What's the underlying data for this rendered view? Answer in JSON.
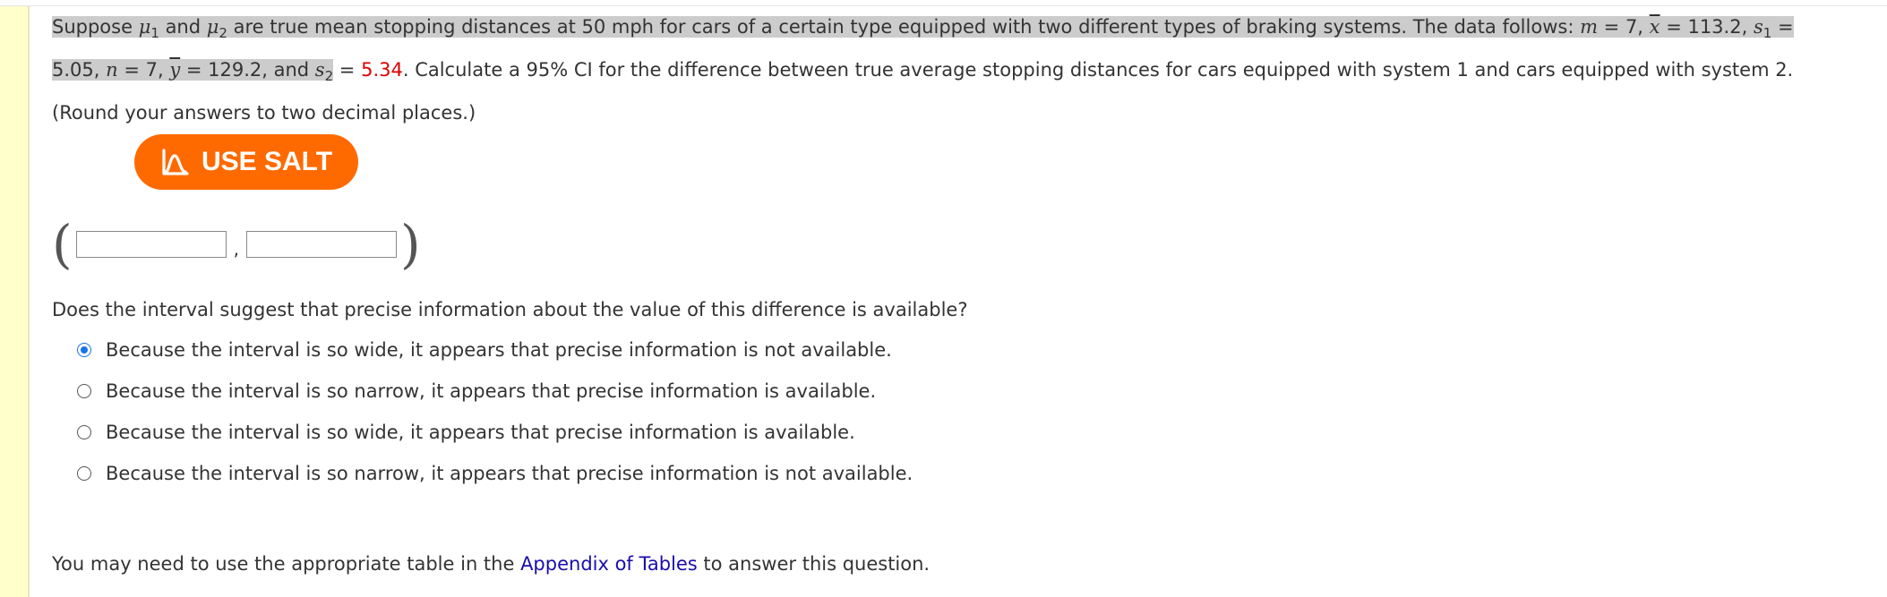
{
  "problem": {
    "p1_a": "Suppose ",
    "mu": "μ",
    "sub1": "1",
    "sub2": "2",
    "p1_b": " and ",
    "p1_c": " are true mean stopping distances at 50 mph for cars of a certain type equipped with two different types of braking systems. The data follows: ",
    "m_sym": "m",
    "m_val": " = 7, ",
    "x_sym": "x",
    "x_val": " = 113.2,",
    "s_sym": "s",
    "s1_val": " = 5.05, ",
    "n_sym": "n",
    "n_val": " = 7, ",
    "y_sym": "y",
    "y_val": " = 129.2, and ",
    "s2_eq": " = ",
    "s2_val": "5.34",
    "p_end": ". Calculate a 95% CI for the difference between true average stopping distances for cars equipped with system 1 and cars equipped with system 2. (Round your answers to two decimal places.)"
  },
  "salt_button": {
    "label": "USE SALT"
  },
  "ci": {
    "open": "(",
    "close": ")",
    "sep": ",",
    "lower_value": "",
    "upper_value": ""
  },
  "question": "Does the interval suggest that precise information about the value of this difference is available?",
  "options": [
    {
      "label": "Because the interval is so wide, it appears that precise information is not available.",
      "selected": true
    },
    {
      "label": "Because the interval is so narrow, it appears that precise information is available.",
      "selected": false
    },
    {
      "label": "Because the interval is so wide, it appears that precise information is available.",
      "selected": false
    },
    {
      "label": "Because the interval is so narrow, it appears that precise information is not available.",
      "selected": false
    }
  ],
  "footer": {
    "before": "You may need to use the appropriate table in the ",
    "link": "Appendix of Tables",
    "after": " to answer this question."
  },
  "colors": {
    "salt_orange": "#ff6a00",
    "left_bar": "#ffffcc",
    "highlight": "#cccccc",
    "red_value": "#e00000",
    "link": "#1a0dab",
    "radio_selected": "#1a73e8"
  }
}
